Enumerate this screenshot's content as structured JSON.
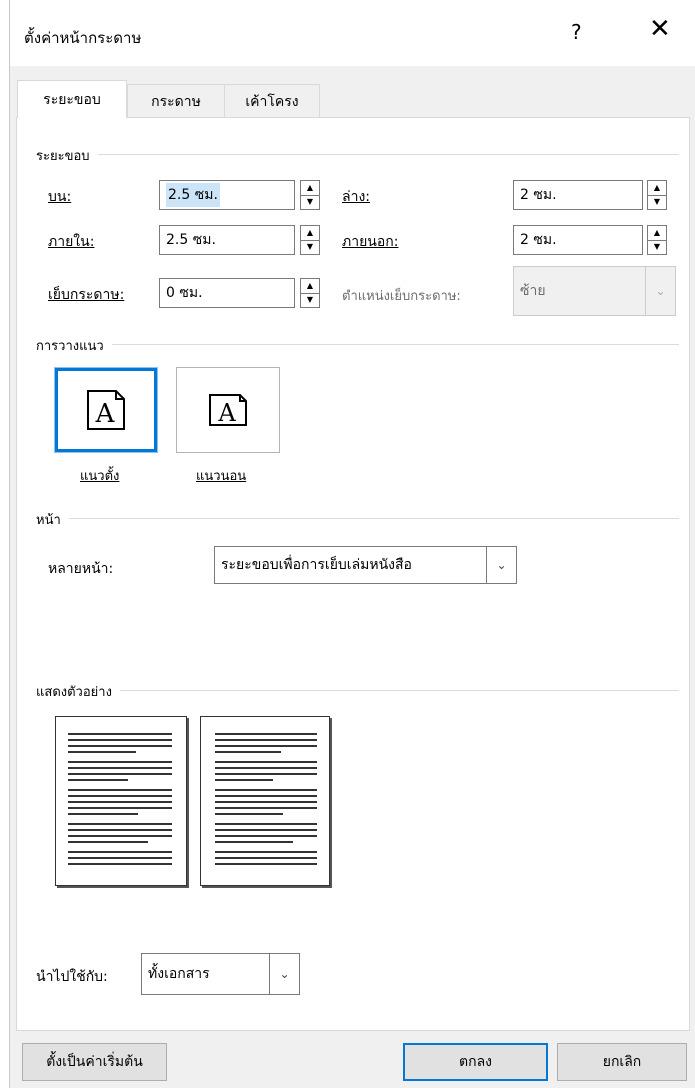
{
  "window": {
    "title": "ตั้งค่าหน้ากระดาษ",
    "help_label": "?",
    "close_label": "✕"
  },
  "tabs": [
    {
      "label": "ระยะขอบ",
      "active": true
    },
    {
      "label": "กระดาษ",
      "active": false
    },
    {
      "label": "เค้าโครง",
      "active": false
    }
  ],
  "margins": {
    "section_title": "ระยะขอบ",
    "top_label": "บน:",
    "top_value": "2.5 ซม.",
    "bottom_label": "ล่าง:",
    "bottom_value": "2 ซม.",
    "inside_label": "ภายใน:",
    "inside_value": "2.5 ซม.",
    "outside_label": "ภายนอก:",
    "outside_value": "2 ซม.",
    "gutter_label": "เย็บกระดาษ:",
    "gutter_value": "0 ซม.",
    "gutter_pos_label": "ตำแหน่งเย็บกระดาษ:",
    "gutter_pos_value": "ซ้าย"
  },
  "orientation": {
    "section_title": "การวางแนว",
    "portrait_label": "แนวตั้ง",
    "landscape_label": "แนวนอน",
    "icon_letter": "A"
  },
  "pages": {
    "section_title": "หน้า",
    "multiple_label": "หลายหน้า:",
    "multiple_value": "ระยะขอบเพื่อการเย็บเล่มหนังสือ"
  },
  "preview": {
    "section_title": "แสดงตัวอย่าง"
  },
  "apply": {
    "label": "นำไปใช้กับ:",
    "value": "ทั้งเอกสาร"
  },
  "buttons": {
    "set_default": "ตั้งเป็นค่าเริ่มต้น",
    "ok": "ตกลง",
    "cancel": "ยกเลิก"
  },
  "colors": {
    "accent": "#0078d7",
    "selection": "#cce4f7"
  }
}
